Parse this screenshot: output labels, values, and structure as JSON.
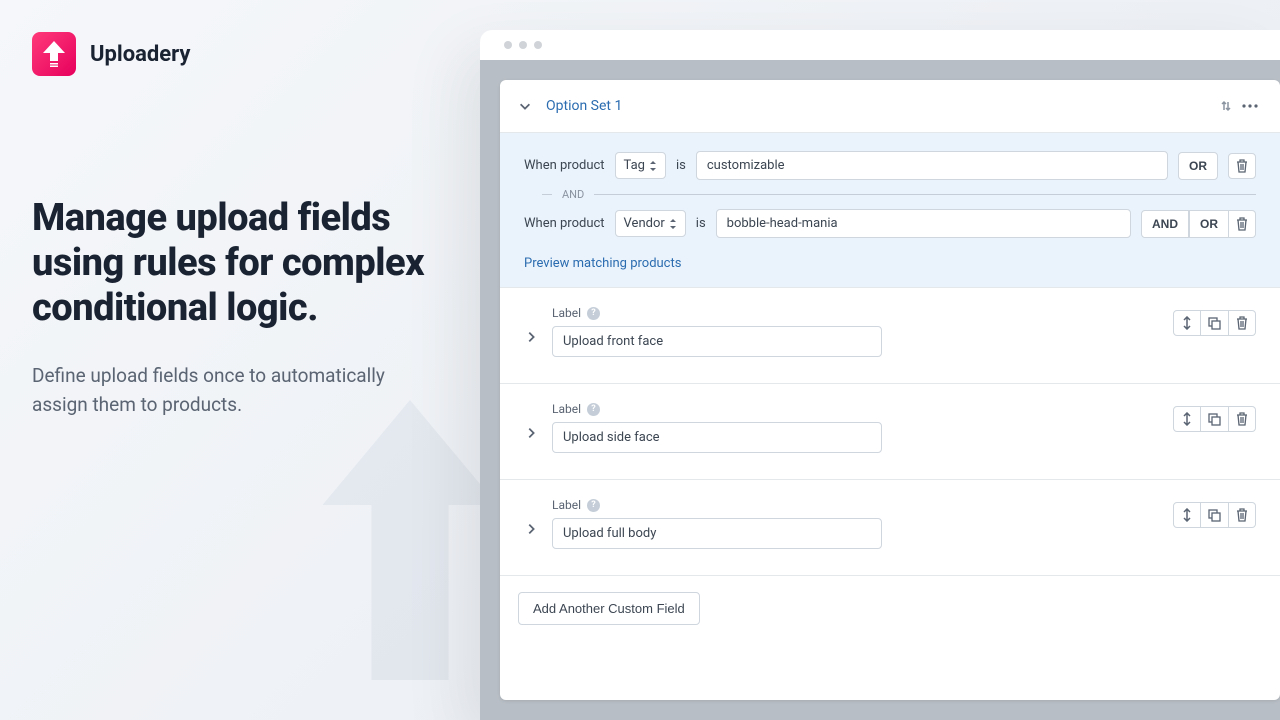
{
  "brand": {
    "name": "Uploadery"
  },
  "hero": {
    "headline": "Manage upload fields using rules for complex conditional logic.",
    "subhead": "Define upload fields once to automatically assign them to products."
  },
  "optionSet": {
    "title": "Option Set 1",
    "previewLink": "Preview matching products",
    "andLabel": "AND",
    "conditions": [
      {
        "prefix": "When product",
        "attr": "Tag",
        "op": "is",
        "value": "customizable",
        "ops": [
          "OR"
        ]
      },
      {
        "prefix": "When product",
        "attr": "Vendor",
        "op": "is",
        "value": "bobble-head-mania",
        "ops": [
          "AND",
          "OR"
        ]
      }
    ],
    "fields": [
      {
        "labelCaption": "Label",
        "value": "Upload front face"
      },
      {
        "labelCaption": "Label",
        "value": "Upload side face"
      },
      {
        "labelCaption": "Label",
        "value": "Upload full body"
      }
    ],
    "addButton": "Add Another Custom Field"
  }
}
